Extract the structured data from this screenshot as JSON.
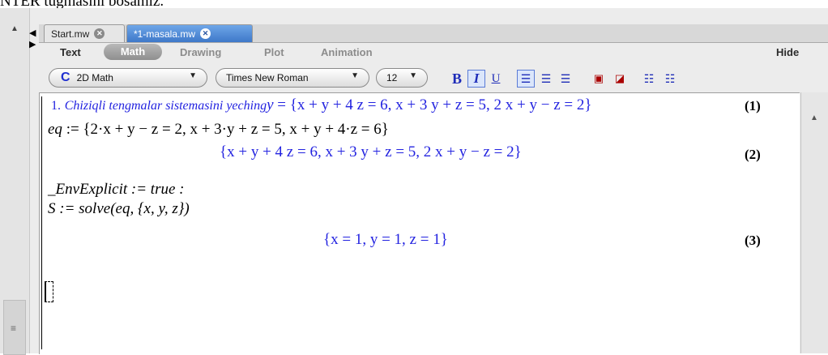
{
  "caption": "NTER tugmasini bosamiz.",
  "tabs": [
    {
      "label": "Start.mw",
      "active": false
    },
    {
      "label": "*1-masala.mw",
      "active": true
    }
  ],
  "modes": {
    "text": "Text",
    "math": "Math",
    "drawing": "Drawing",
    "plot": "Plot",
    "animation": "Animation",
    "hide": "Hide"
  },
  "toolbar": {
    "mode_icon": "C",
    "mode_value": "2D Math",
    "font_value": "Times New Roman",
    "size_value": "12",
    "bold": "B",
    "italic": "I",
    "underline": "U"
  },
  "worksheet": {
    "line1_num": "1.",
    "line1_title": "Chiziqli tengmalar sistemasini yeching",
    "line1_var": "y",
    "line1_expr": " = {x + y + 4 z = 6, x + 3 y + z = 5, 2 x + y − z = 2}",
    "label1": "(1)",
    "eq_input_name": "eq",
    "eq_input_rest": " := {2·x + y − z = 2, x + 3·y + z = 5, x + y + 4·z = 6}",
    "eq_output": "{x + y + 4 z = 6, x + 3 y + z = 5, 2 x + y − z = 2}",
    "label2": "(2)",
    "env_name": "_EnvExplicit",
    "env_rest": " := true :",
    "solve_name": "S",
    "solve_rest": " := solve(eq, {x, y, z})",
    "solve_output": "{x = 1, y = 1, z = 1}",
    "label3": "(3)"
  },
  "colors": {
    "input_text": "#000000",
    "output_text": "#2323e0",
    "active_tab": "#3e78c9"
  }
}
